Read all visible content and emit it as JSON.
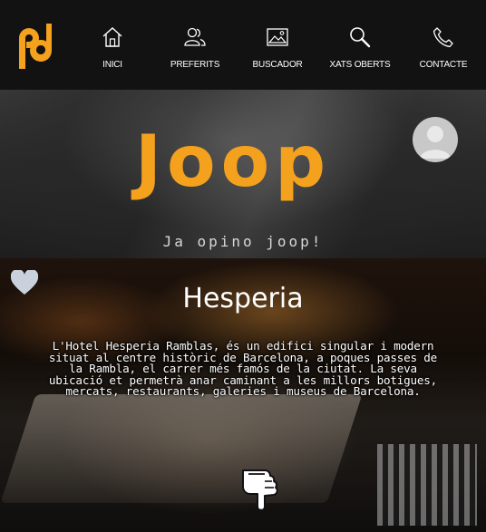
{
  "nav": {
    "items": [
      {
        "label": "INICI",
        "icon": "home-icon"
      },
      {
        "label": "PREFERITS",
        "icon": "users-icon"
      },
      {
        "label": "BUSCADOR",
        "icon": "image-icon"
      },
      {
        "label": "XATS OBERTS",
        "icon": "search-icon"
      },
      {
        "label": "CONTACTE",
        "icon": "phone-icon"
      }
    ]
  },
  "logo": {
    "icon": "pd-logo-icon"
  },
  "hero": {
    "brand": "Joop",
    "tagline": "Ja opino joop!",
    "avatar_icon": "user-avatar-icon"
  },
  "restaurant": {
    "name": "Hesperia",
    "description": "L'Hotel Hesperia Ramblas, és un edifici singular i modern situat al centre històric de Barcelona, a poques passes de la Rambla, el carrer més famós de la ciutat. La seva ubicació et permetrà anar caminant a les millors botigues, mercats, restaurants, galeries i museus de Barcelona.",
    "favorite_icon": "heart-icon",
    "next_icon": "pointing-hand-icon"
  },
  "colors": {
    "accent": "#f4a11e",
    "topbar": "#121212",
    "text": "#ffffff"
  }
}
